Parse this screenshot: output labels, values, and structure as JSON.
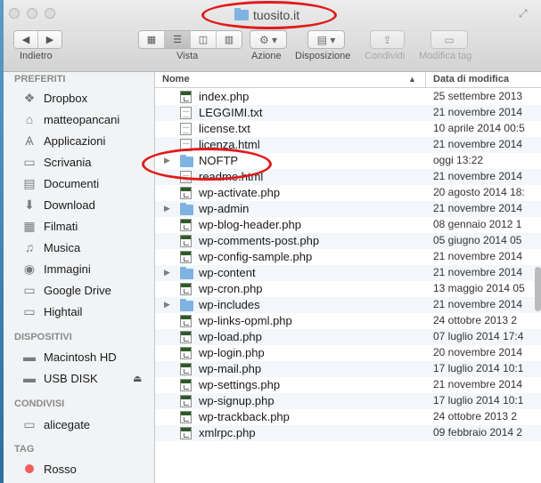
{
  "window": {
    "title": "tuosito.it"
  },
  "toolbar": {
    "back_label": "Indietro",
    "view_label": "Vista",
    "action_label": "Azione",
    "arrange_label": "Disposizione",
    "share_label": "Condividi",
    "tags_label": "Modifica tag"
  },
  "sidebar": {
    "favorites_header": "PREFERITI",
    "favorites": [
      {
        "label": "Dropbox",
        "icon": "dropbox-icon"
      },
      {
        "label": "matteopancani",
        "icon": "home-icon"
      },
      {
        "label": "Applicazioni",
        "icon": "applications-icon"
      },
      {
        "label": "Scrivania",
        "icon": "desktop-icon"
      },
      {
        "label": "Documenti",
        "icon": "documents-icon"
      },
      {
        "label": "Download",
        "icon": "download-icon"
      },
      {
        "label": "Filmati",
        "icon": "movies-icon"
      },
      {
        "label": "Musica",
        "icon": "music-icon"
      },
      {
        "label": "Immagini",
        "icon": "pictures-icon"
      },
      {
        "label": "Google Drive",
        "icon": "folder-icon"
      },
      {
        "label": "Hightail",
        "icon": "folder-icon"
      }
    ],
    "devices_header": "DISPOSITIVI",
    "devices": [
      {
        "label": "Macintosh HD",
        "icon": "hard-disk-icon"
      },
      {
        "label": "USB DISK",
        "icon": "usb-disk-icon"
      }
    ],
    "shared_header": "CONDIVISI",
    "shared": [
      {
        "label": "alicegate",
        "icon": "network-computer-icon"
      }
    ],
    "tags_header": "TAG",
    "tags": [
      {
        "label": "Rosso",
        "color": "#f25e5e"
      }
    ]
  },
  "list": {
    "col_name": "Nome",
    "col_date": "Data di modifica",
    "files": [
      {
        "name": "index.php",
        "date": "25 settembre 2013",
        "kind": "php"
      },
      {
        "name": "LEGGIMI.txt",
        "date": "21 novembre 2014",
        "kind": "txt"
      },
      {
        "name": "license.txt",
        "date": "10 aprile 2014 00:5",
        "kind": "txt"
      },
      {
        "name": "licenza.html",
        "date": "21 novembre 2014",
        "kind": "txt"
      },
      {
        "name": "NOFTP",
        "date": "oggi 13:22",
        "kind": "folder"
      },
      {
        "name": "readme.html",
        "date": "21 novembre 2014",
        "kind": "txt"
      },
      {
        "name": "wp-activate.php",
        "date": "20 agosto 2014 18:",
        "kind": "php"
      },
      {
        "name": "wp-admin",
        "date": "21 novembre 2014",
        "kind": "folder"
      },
      {
        "name": "wp-blog-header.php",
        "date": "08 gennaio 2012 1",
        "kind": "php"
      },
      {
        "name": "wp-comments-post.php",
        "date": "05 giugno 2014 05",
        "kind": "php"
      },
      {
        "name": "wp-config-sample.php",
        "date": "21 novembre 2014",
        "kind": "php"
      },
      {
        "name": "wp-content",
        "date": "21 novembre 2014",
        "kind": "folder"
      },
      {
        "name": "wp-cron.php",
        "date": "13 maggio 2014 05",
        "kind": "php"
      },
      {
        "name": "wp-includes",
        "date": "21 novembre 2014",
        "kind": "folder"
      },
      {
        "name": "wp-links-opml.php",
        "date": "24 ottobre 2013 2",
        "kind": "php"
      },
      {
        "name": "wp-load.php",
        "date": "07 luglio 2014 17:4",
        "kind": "php"
      },
      {
        "name": "wp-login.php",
        "date": "20 novembre 2014",
        "kind": "php"
      },
      {
        "name": "wp-mail.php",
        "date": "17 luglio 2014 10:1",
        "kind": "php"
      },
      {
        "name": "wp-settings.php",
        "date": "21 novembre 2014",
        "kind": "php"
      },
      {
        "name": "wp-signup.php",
        "date": "17 luglio 2014 10:1",
        "kind": "php"
      },
      {
        "name": "wp-trackback.php",
        "date": "24 ottobre 2013 2",
        "kind": "php"
      },
      {
        "name": "xmlrpc.php",
        "date": "09 febbraio 2014 2",
        "kind": "php"
      }
    ]
  }
}
